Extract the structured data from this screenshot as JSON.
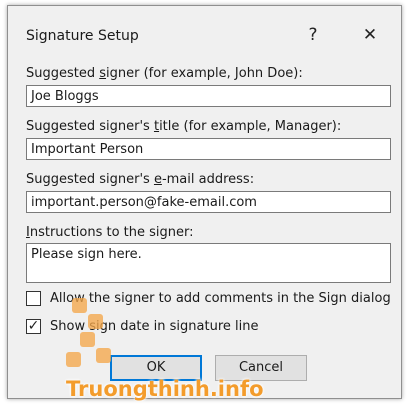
{
  "dialog": {
    "title": "Signature Setup",
    "help_label": "?",
    "close_label": "✕"
  },
  "fields": {
    "signer_label_pre": "Suggested ",
    "signer_label_key": "s",
    "signer_label_post": "igner (for example, John Doe):",
    "signer_value": "Joe Bloggs",
    "title_label_pre": "Suggested signer's ",
    "title_label_key": "t",
    "title_label_post": "itle (for example, Manager):",
    "title_value": "Important Person",
    "email_label_pre": "Suggested signer's ",
    "email_label_key": "e",
    "email_label_post": "-mail address:",
    "email_value": "important.person@fake-email.com",
    "instructions_label_key": "I",
    "instructions_label_post": "nstructions to the signer:",
    "instructions_value": "Please sign here."
  },
  "options": {
    "allow_comments_label": "Allow the signer to add comments in the Sign dialog",
    "allow_comments_checked": false,
    "show_date_label": "Show sign date in signature line",
    "show_date_checked": true,
    "check_glyph": "✓"
  },
  "buttons": {
    "ok": "OK",
    "cancel": "Cancel"
  },
  "watermark": {
    "text": "Truongthinh.info",
    "color": "#f39c2c"
  }
}
